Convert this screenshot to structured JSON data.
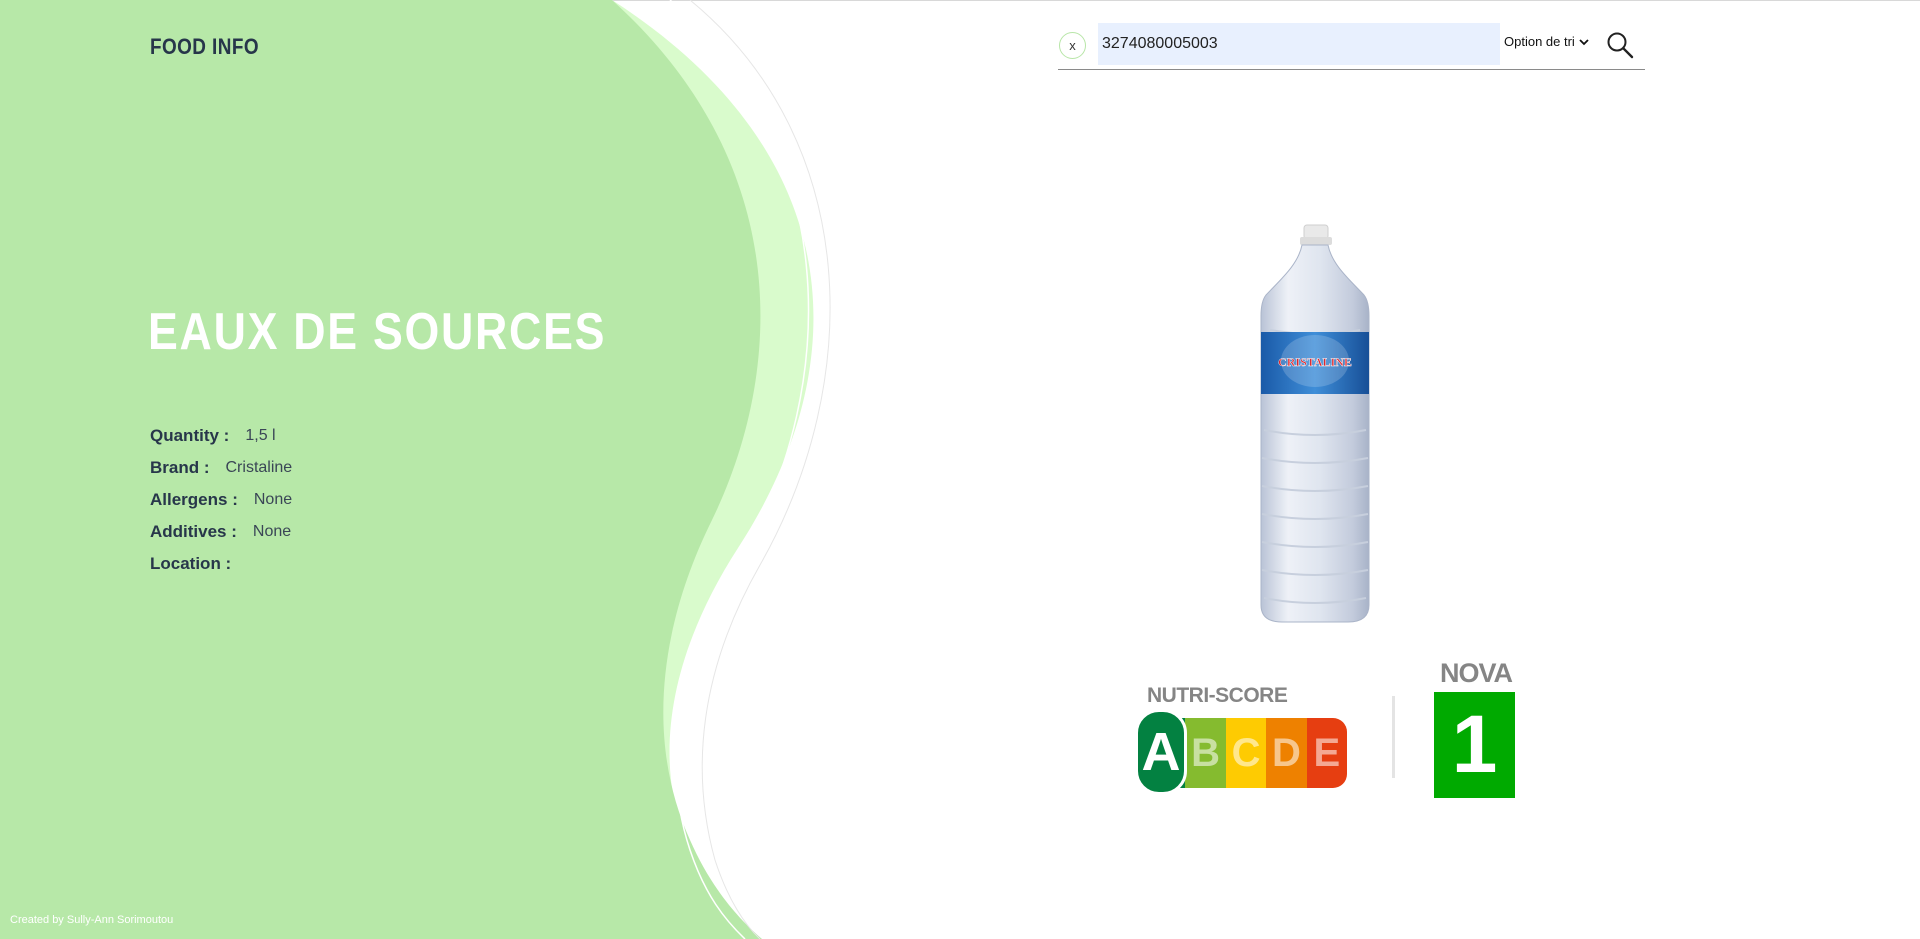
{
  "app": {
    "logo": "FOOD INFO"
  },
  "search": {
    "clear_label": "x",
    "value": "3274080005003",
    "sort_label": "Option de tri"
  },
  "product": {
    "name": "EAUX DE SOURCES",
    "bottle_brand_text": "CRISTALINE",
    "fields": [
      {
        "label": "Quantity :",
        "value": "1,5 l"
      },
      {
        "label": "Brand :",
        "value": "Cristaline"
      },
      {
        "label": "Allergens :",
        "value": "None"
      },
      {
        "label": "Additives :",
        "value": "None"
      },
      {
        "label": "Location :",
        "value": ""
      }
    ]
  },
  "scores": {
    "nutri_title": "NUTRI-SCORE",
    "nutri_grades": [
      "A",
      "B",
      "C",
      "D",
      "E"
    ],
    "nutri_selected": "A",
    "nutri_colors": [
      "#038141",
      "#85bb2f",
      "#fecb02",
      "#ee8100",
      "#e63e11"
    ],
    "nova_title": "NOVA",
    "nova_value": "1",
    "nova_color": "#00aa00"
  },
  "footer": {
    "credit": "Created by Sully-Ann Sorimoutou"
  },
  "theme": {
    "green": "#b7e8a8",
    "light_green": "#d9fbcc",
    "text": "#27364a"
  }
}
